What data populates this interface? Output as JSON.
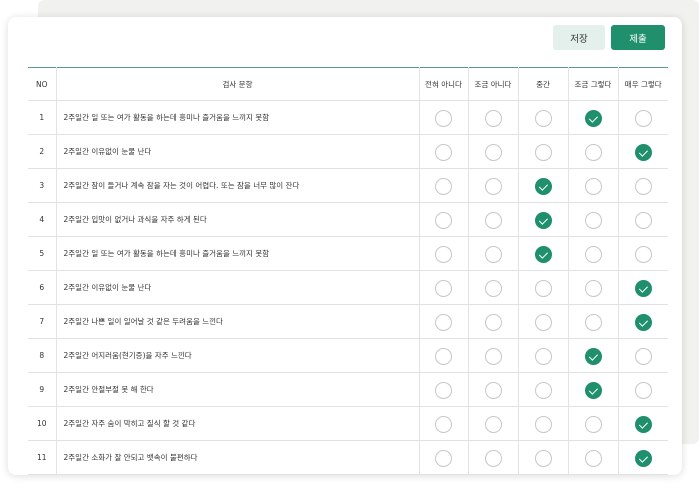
{
  "toolbar": {
    "save_label": "저장",
    "submit_label": "제출"
  },
  "table": {
    "headers": {
      "no": "NO",
      "question": "검사 문항",
      "options": [
        "전혀 아니다",
        "조금 아니다",
        "중간",
        "조금 그렇다",
        "매우 그렇다"
      ]
    },
    "rows": [
      {
        "no": "1",
        "question": "2주일간 일 또는 여가 활동을 하는데 흥미나 즐거움을 느끼지 못함",
        "selected": 3
      },
      {
        "no": "2",
        "question": "2주일간 이유없이 눈물 난다",
        "selected": 4
      },
      {
        "no": "3",
        "question": "2주일간 잠이 들거나 계속 잠을 자는 것이 어렵다. 또는 잠을 너무 많이 잔다",
        "selected": 2
      },
      {
        "no": "4",
        "question": "2주일간 입맛이 없거나 과식을 자주 하게 된다",
        "selected": 2
      },
      {
        "no": "5",
        "question": "2주일간 일 또는 여가 활동을 하는데 흥미나 즐거움을 느끼지 못함",
        "selected": 2
      },
      {
        "no": "6",
        "question": "2주일간 이유없이 눈물 난다",
        "selected": 4
      },
      {
        "no": "7",
        "question": "2주일간 나쁜 일이 일어날 것 같은 두려움을 느낀다",
        "selected": 4
      },
      {
        "no": "8",
        "question": "2주일간 어지러움(현기증)을 자주 느낀다",
        "selected": 3
      },
      {
        "no": "9",
        "question": "2주일간 안절부절 못 해 한다",
        "selected": 3
      },
      {
        "no": "10",
        "question": "2주일간 자주 숨이 막히고 질식 할 것 같다",
        "selected": 4
      },
      {
        "no": "11",
        "question": "2주일간 소화가 잘 안되고 뱃속이 불편하다",
        "selected": 4
      }
    ]
  },
  "colors": {
    "accent": "#1f8f6c",
    "save_bg": "#e3f0eb"
  }
}
